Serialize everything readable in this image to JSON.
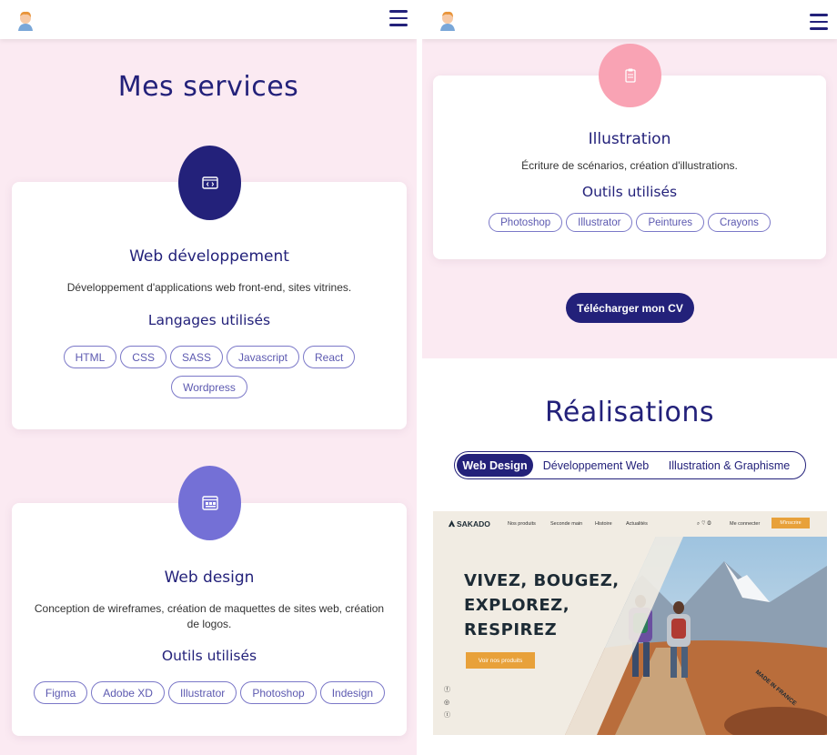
{
  "left": {
    "section_title": "Mes services",
    "cards": [
      {
        "icon": "code-window-icon",
        "title": "Web développement",
        "description": "Développement d'applications web front-end, sites vitrines.",
        "subtitle": "Langages utilisés",
        "tags": [
          "HTML",
          "CSS",
          "SASS",
          "Javascript",
          "React",
          "Wordpress"
        ]
      },
      {
        "icon": "layout-icon",
        "title": "Web design",
        "description": "Conception de wireframes, création de maquettes de sites web, création de logos.",
        "subtitle": "Outils utilisés",
        "tags": [
          "Figma",
          "Adobe XD",
          "Illustrator",
          "Photoshop",
          "Indesign"
        ]
      }
    ]
  },
  "right": {
    "card": {
      "icon": "clipboard-icon",
      "title": "Illustration",
      "description": "Écriture de scénarios, création d'illustrations.",
      "subtitle": "Outils utilisés",
      "tags": [
        "Photoshop",
        "Illustrator",
        "Peintures",
        "Crayons"
      ]
    },
    "cv_button": "Télécharger mon CV",
    "section_title": "Réalisations",
    "filters": [
      "Web Design",
      "Développement Web",
      "Illustration & Graphisme"
    ],
    "active_filter": "Web Design",
    "project_preview": {
      "brand": "SAKADO",
      "nav_links": [
        "Nos produits",
        "Seconde main",
        "Histoire",
        "Actualités"
      ],
      "login": "Me connecter",
      "cta_top": "M'inscrire",
      "headline_lines": [
        "VIVEZ, BOUGEZ,",
        "EXPLOREZ,",
        "RESPIREZ"
      ],
      "cta": "Voir nos produits",
      "badge": "MADE IN FRANCE"
    }
  },
  "colors": {
    "primary": "#23217a",
    "pink_bg": "#fbeaf2",
    "circle_dark": "#23217a",
    "circle_purple": "#7470d6",
    "circle_pink": "#f9a3b4",
    "tag_border": "#7b78c8"
  }
}
